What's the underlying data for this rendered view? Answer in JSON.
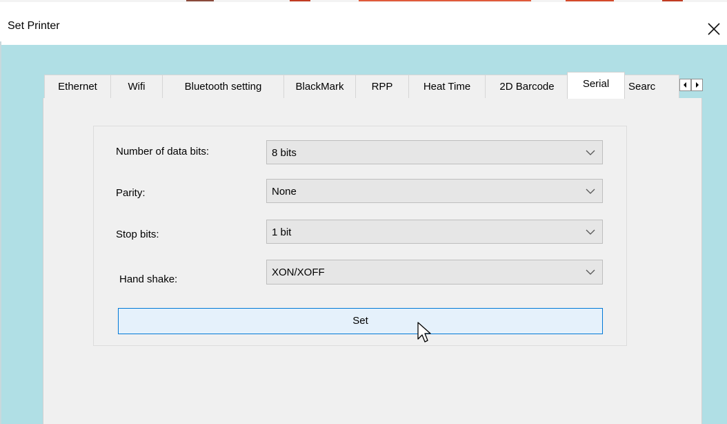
{
  "window": {
    "title": "Set Printer"
  },
  "tabs": [
    {
      "label": "Ethernet"
    },
    {
      "label": "Wifi"
    },
    {
      "label": "Bluetooth setting"
    },
    {
      "label": "BlackMark"
    },
    {
      "label": "RPP"
    },
    {
      "label": "Heat Time"
    },
    {
      "label": "2D Barcode"
    },
    {
      "label": "Serial",
      "active": true
    },
    {
      "label": "Searc"
    }
  ],
  "serial": {
    "data_bits": {
      "label": "Number of data bits:",
      "value": "8 bits"
    },
    "parity": {
      "label": "Parity:",
      "value": "None"
    },
    "stop_bits": {
      "label": "Stop bits:",
      "value": "1 bit"
    },
    "hand_shake": {
      "label": "Hand shake:",
      "value": "XON/XOFF"
    },
    "set_label": "Set"
  },
  "icons": {
    "close": "close-icon",
    "tab_scroll_left": "arrow-left-icon",
    "tab_scroll_right": "arrow-right-icon",
    "dropdown": "chevron-down-icon",
    "cursor": "mouse-pointer-icon"
  },
  "colors": {
    "client_background": "#b0dfe5",
    "panel_background": "#f0f0f0",
    "combo_background": "#e6e6e6",
    "button_background": "#e5f1fb",
    "button_border": "#0078d7"
  }
}
